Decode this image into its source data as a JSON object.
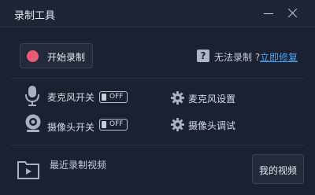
{
  "window": {
    "title": "录制工具"
  },
  "record": {
    "start_label": "开始录制"
  },
  "help": {
    "icon": "?",
    "cant_record": "无法录制 ?",
    "fix_link": "立即修复"
  },
  "devices": {
    "mic": {
      "label": "麦克风开关",
      "toggle": "OFF",
      "settings_label": "麦克风设置"
    },
    "camera": {
      "label": "摄像头开关",
      "toggle": "OFF",
      "settings_label": "摄像头调试"
    }
  },
  "recent": {
    "label": "最近录制视频",
    "my_videos_label": "我的视频"
  },
  "colors": {
    "background": "#1b2130",
    "record_dot": "#ec5a74",
    "link": "#4ea3f0"
  }
}
